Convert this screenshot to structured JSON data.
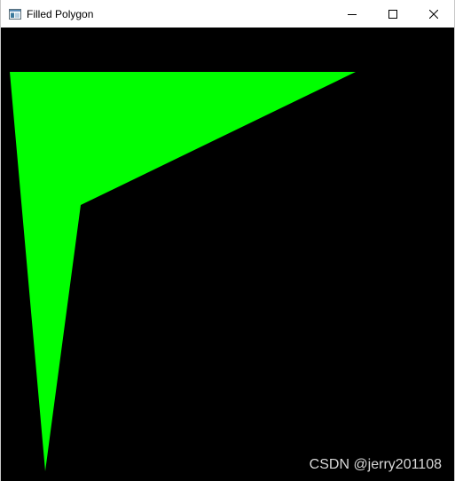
{
  "window": {
    "title": "Filled Polygon",
    "icon": "app-window-icon",
    "controls": {
      "minimize_icon": "minimize-icon",
      "maximize_icon": "maximize-icon",
      "close_icon": "close-icon"
    }
  },
  "canvas": {
    "background_color": "#000000",
    "polygon_fill_color": "#00ff00"
  },
  "watermark": {
    "text": "CSDN @jerry201108"
  }
}
